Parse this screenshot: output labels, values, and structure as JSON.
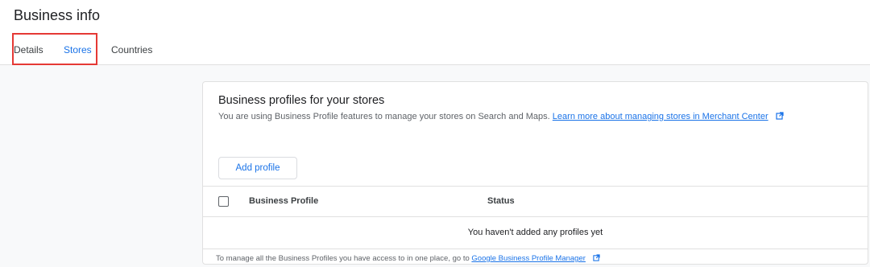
{
  "header": {
    "title": "Business info",
    "tabs": [
      {
        "label": "Details"
      },
      {
        "label": "Stores"
      },
      {
        "label": "Countries"
      }
    ]
  },
  "card": {
    "title": "Business profiles for your stores",
    "description": "You are using Business Profile features to manage your stores on Search and Maps.",
    "learn_more_link": "Learn more about managing stores in Merchant Center",
    "add_button_label": "Add profile",
    "table": {
      "columns": [
        "Business Profile",
        "Status"
      ],
      "empty_message": "You haven't added any profiles yet"
    },
    "footer": {
      "text": "To manage all the Business Profiles you have access to in one place, go to",
      "link": "Google Business Profile Manager"
    }
  },
  "colors": {
    "accent": "#1a73e8",
    "highlight": "#e53935",
    "background": "#f8f9fa"
  },
  "icons": {
    "external_link": "external-link-icon"
  }
}
